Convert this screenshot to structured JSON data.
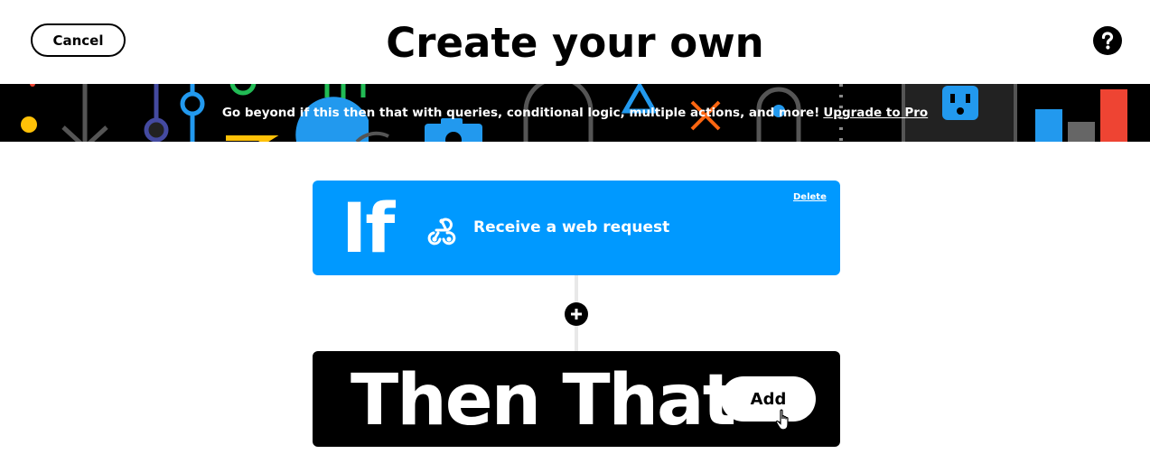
{
  "header": {
    "cancel_label": "Cancel",
    "title": "Create your own",
    "help_icon": "question-circle-icon"
  },
  "banner": {
    "message": "Go beyond if this then that with queries, conditional logic, multiple actions, and more!",
    "upgrade_link": "Upgrade to Pro"
  },
  "if_card": {
    "keyword": "If",
    "trigger_icon": "webhook-icon",
    "trigger_label": "Receive a web request",
    "delete_label": "Delete",
    "color": "#0099ff"
  },
  "connector": {
    "add_step_icon": "plus-icon"
  },
  "then_card": {
    "keyword": "Then That",
    "add_label": "Add",
    "color": "#000000"
  }
}
